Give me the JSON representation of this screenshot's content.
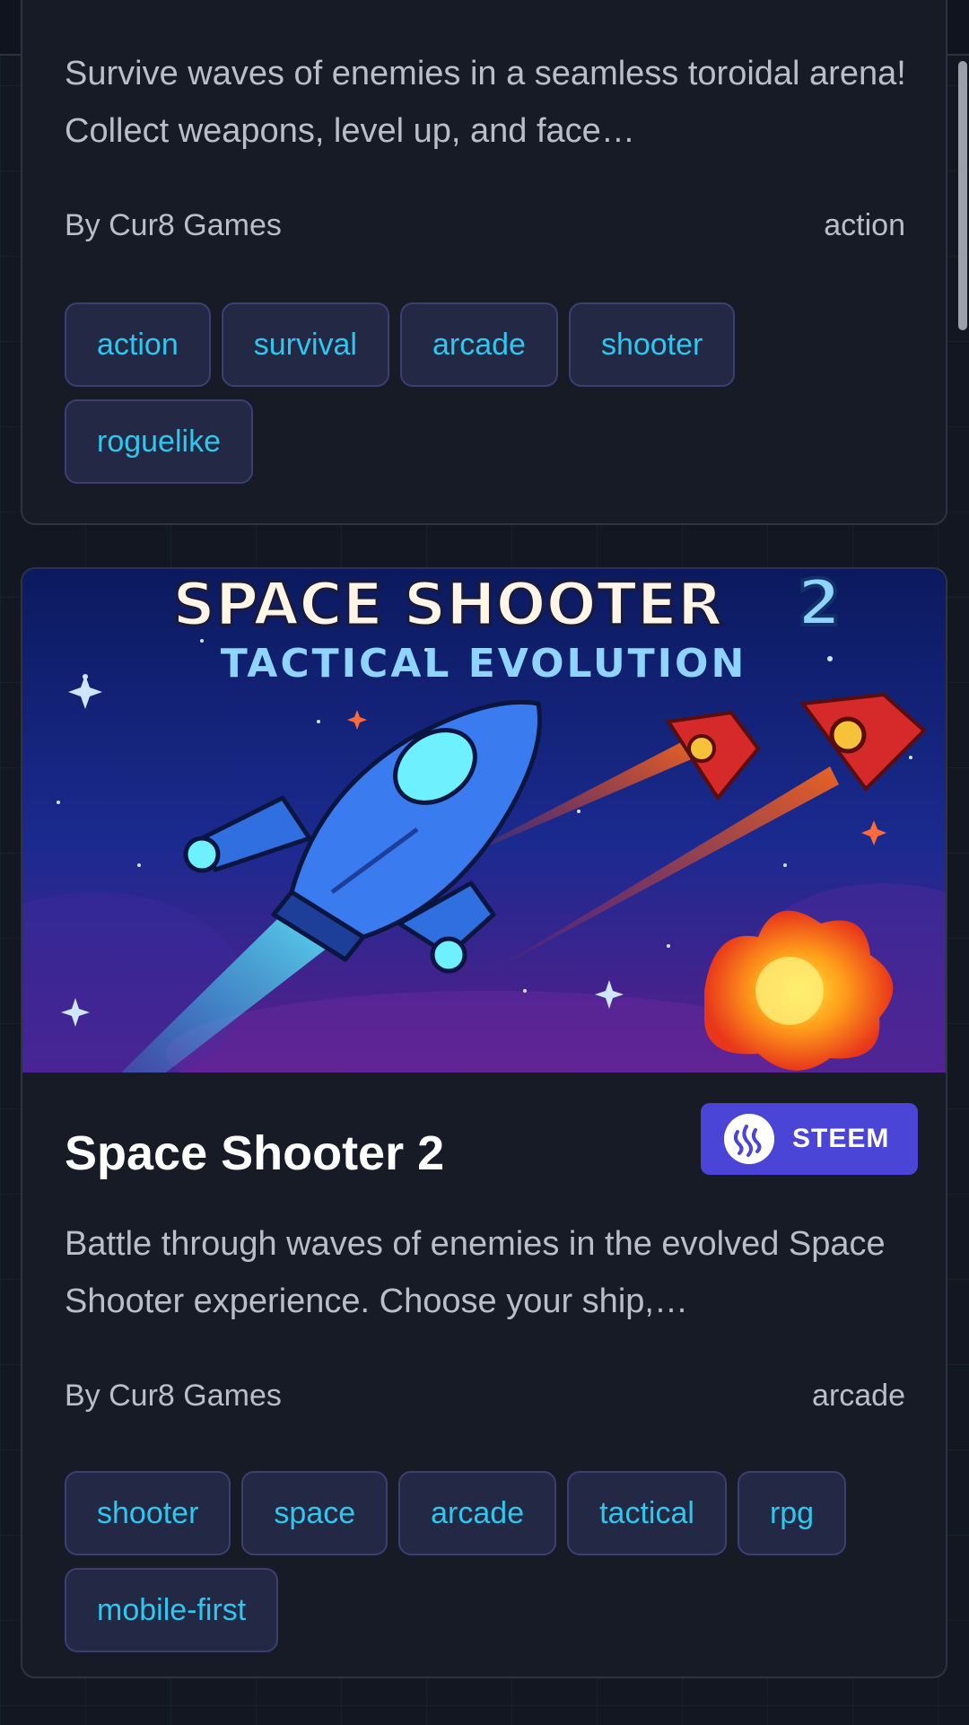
{
  "card_1": {
    "description": "Survive waves of enemies in a seamless toroidal arena! Collect weapons, level up, and face…",
    "author": "By Cur8 Games",
    "category": "action",
    "tags": [
      "action",
      "survival",
      "arcade",
      "shooter",
      "roguelike"
    ]
  },
  "card_2": {
    "cover": {
      "title": "SPACE SHOOTER",
      "number": "2",
      "subtitle": "TACTICAL EVOLUTION"
    },
    "title": "Space Shooter 2",
    "chain_badge": "STEEM",
    "description": "Battle through waves of enemies in the evolved Space Shooter experience. Choose your ship,…",
    "author": "By Cur8 Games",
    "category": "arcade",
    "tags": [
      "shooter",
      "space",
      "arcade",
      "tactical",
      "rpg",
      "mobile-first"
    ]
  },
  "colors": {
    "background": "#121722",
    "card": "#161b26",
    "tag_text": "#2ec7ef",
    "tag_bg": "#232844",
    "badge": "#4a45d6"
  },
  "icons": [
    "steem-icon"
  ]
}
